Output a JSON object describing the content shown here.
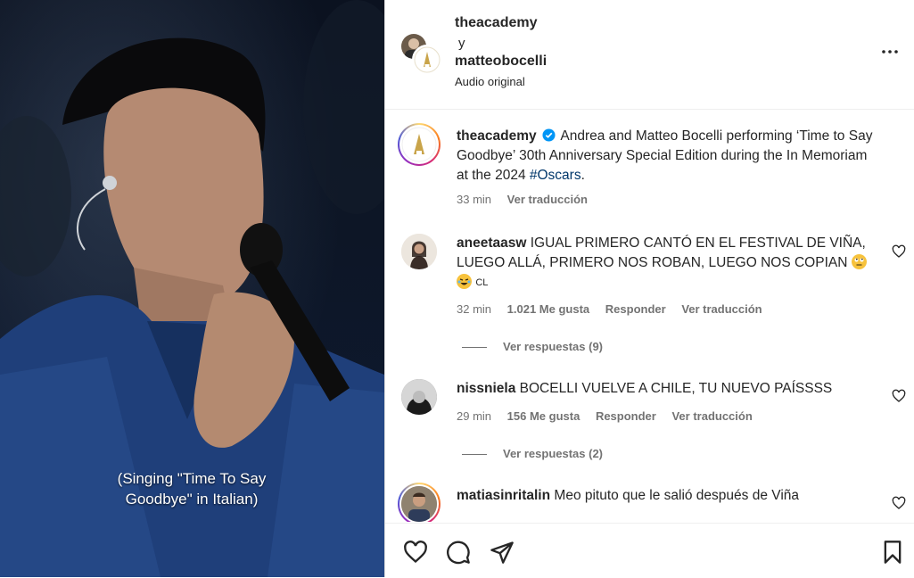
{
  "video": {
    "caption": "(Singing \"Time To Say Goodbye\" in Italian)"
  },
  "header": {
    "user1": "theacademy",
    "connector": "y",
    "user2": "matteobocelli",
    "audio": "Audio original"
  },
  "post": {
    "username": "theacademy",
    "text_before": "Andrea and Matteo Bocelli performing ‘Time to Say Goodbye’ 30th Anniversary Special Edition during the In Memoriam at the 2024 ",
    "hashtag": "#Oscars",
    "text_after": ".",
    "time": "33 min",
    "translate": "Ver traducción"
  },
  "comments": [
    {
      "username": "aneetaasw",
      "line1": "IGUAL PRIMERO CANTÓ EN EL FESTIVAL DE VIÑA,",
      "line2": "LUEGO ALLÁ, PRIMERO NOS ROBAN, LUEGO NOS COPIAN",
      "line3_tail": "CL",
      "time": "32 min",
      "likes": "1.021 Me gusta",
      "reply": "Responder",
      "translate": "Ver traducción",
      "view_replies": "Ver respuestas (9)"
    },
    {
      "username": "nissniela",
      "line1": "BOCELLI VUELVE A CHILE, TU NUEVO PAÍSSSS",
      "time": "29 min",
      "likes": "156 Me gusta",
      "reply": "Responder",
      "translate": "Ver traducción",
      "view_replies": "Ver respuestas (2)"
    },
    {
      "username": "matiasinritalin",
      "line1": "Meo pituto que le salió después de Viña"
    }
  ],
  "icons": [
    "more-icon",
    "verified-icon",
    "heart-icon",
    "comment-icon",
    "share-icon",
    "bookmark-icon"
  ],
  "colors": {
    "link": "#00376b",
    "verified": "#0095f6",
    "muted": "#737373"
  }
}
